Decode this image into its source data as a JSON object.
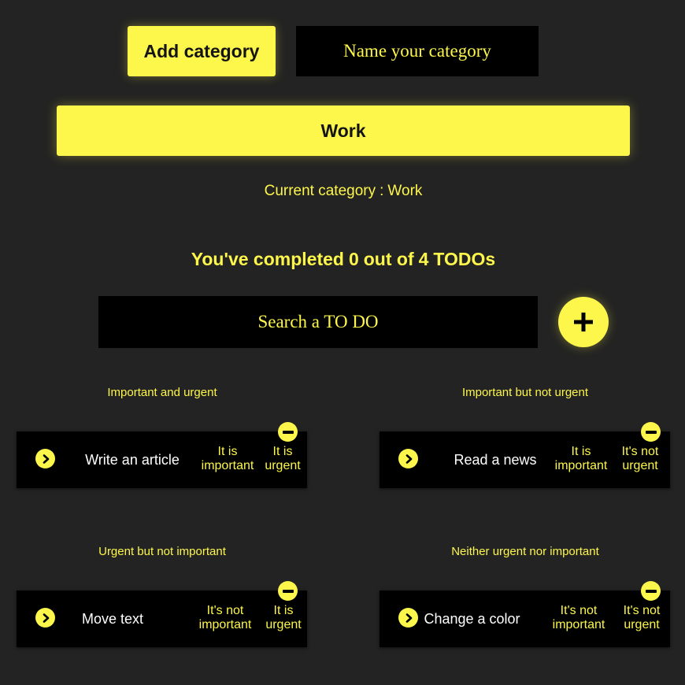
{
  "header": {
    "add_category_label": "Add category",
    "category_name_placeholder": "Name your category"
  },
  "categories": [
    {
      "label": "Work"
    }
  ],
  "current_category": {
    "label": "Current category",
    "separator": ":",
    "value": "Work"
  },
  "progress": {
    "prefix": "You've completed",
    "completed": "0",
    "middle": "out of",
    "total": "4",
    "suffix": "TODOs"
  },
  "search": {
    "placeholder": "Search a TO DO",
    "add_icon": "plus-icon"
  },
  "quadrants": [
    {
      "title": "Important and urgent",
      "todos": [
        {
          "text": "Write an article",
          "importance": [
            "It is",
            "important"
          ],
          "urgency": [
            "It is",
            "urgent"
          ]
        }
      ]
    },
    {
      "title": "Important but not urgent",
      "todos": [
        {
          "text": "Read a news",
          "importance": [
            "It is",
            "important"
          ],
          "urgency": [
            "It's not",
            "urgent"
          ]
        }
      ]
    },
    {
      "title": "Urgent but not important",
      "todos": [
        {
          "text": "Move text",
          "importance": [
            "It's not",
            "important"
          ],
          "urgency": [
            "It is",
            "urgent"
          ]
        }
      ]
    },
    {
      "title": "Neither urgent nor important",
      "todos": [
        {
          "text": "Change a color",
          "importance": [
            "It's not",
            "important"
          ],
          "urgency": [
            "It's not",
            "urgent"
          ]
        }
      ]
    }
  ],
  "icons": {
    "complete": "chevron-right-circle-icon",
    "remove": "minus-circle-icon"
  },
  "colors": {
    "background": "#232323",
    "accent": "#fdf64b",
    "card": "#000000",
    "task_text": "#ffffff"
  }
}
